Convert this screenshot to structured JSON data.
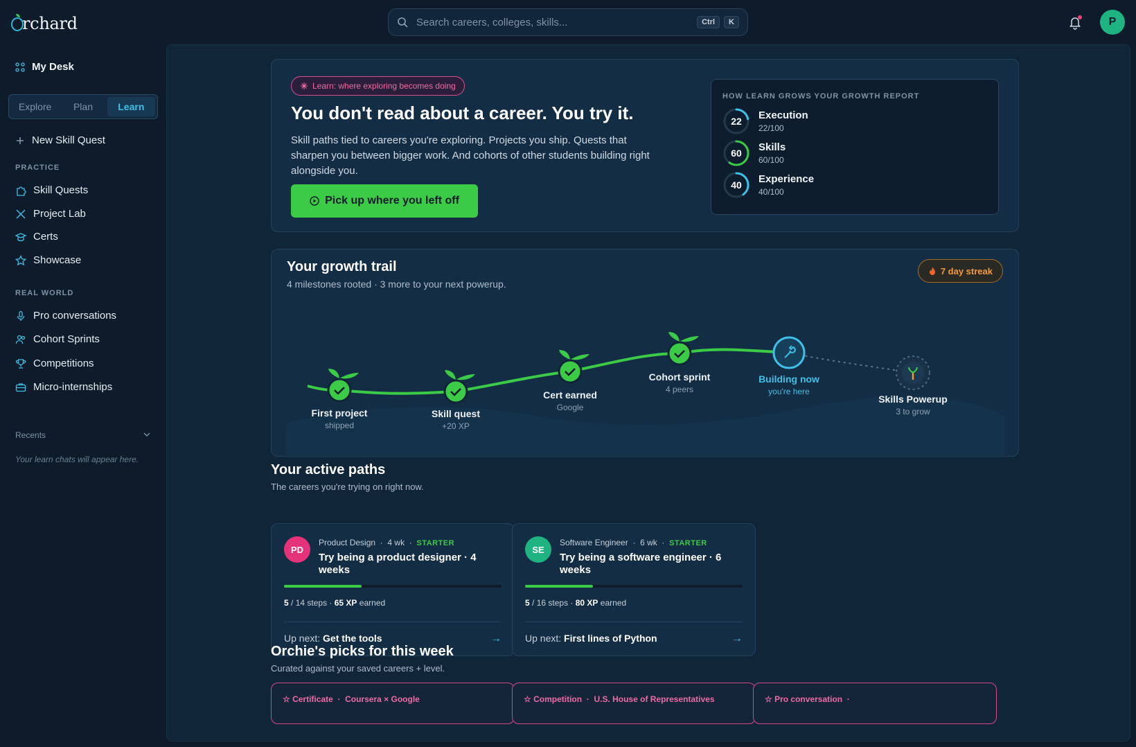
{
  "app": {
    "name": "rchard",
    "logo_letter": "O"
  },
  "search": {
    "placeholder": "Search careers, colleges, skills...",
    "kbd1": "Ctrl",
    "kbd2": "K"
  },
  "user": {
    "initial": "P"
  },
  "sidebar": {
    "my_desk": "My Desk",
    "tabs": [
      {
        "label": "Explore"
      },
      {
        "label": "Plan"
      },
      {
        "label": "Learn",
        "active": true
      }
    ],
    "new_quest": "New Skill Quest",
    "practice_title": "PRACTICE",
    "practice": [
      {
        "label": "Skill Quests",
        "icon": "puzzle-icon"
      },
      {
        "label": "Project Lab",
        "icon": "tools-icon"
      },
      {
        "label": "Certs",
        "icon": "graduation-cap-icon"
      },
      {
        "label": "Showcase",
        "icon": "star-icon"
      }
    ],
    "real_world_title": "REAL WORLD",
    "real_world": [
      {
        "label": "Pro conversations",
        "icon": "microphone-icon"
      },
      {
        "label": "Cohort Sprints",
        "icon": "users-icon"
      },
      {
        "label": "Competitions",
        "icon": "trophy-icon"
      },
      {
        "label": "Micro-internships",
        "icon": "briefcase-icon"
      }
    ],
    "recents_title": "Recents",
    "recents_empty": "Your learn chats will appear here."
  },
  "hero": {
    "pill": "Learn: where exploring becomes doing",
    "title": "You don't read about a career. You try it.",
    "body": "Skill paths tied to careers you're exploring. Projects you ship. Quests that sharpen you between bigger work. And cohorts of other students building right alongside you.",
    "cta": "Pick up where you left off",
    "report": {
      "title": "HOW LEARN GROWS YOUR GROWTH REPORT",
      "rows": [
        {
          "value": "22",
          "label": "Execution",
          "sub": "22/100",
          "pct": 0.22
        },
        {
          "value": "60",
          "label": "Skills",
          "sub": "60/100",
          "pct": 0.6
        },
        {
          "value": "40",
          "label": "Experience",
          "sub": "40/100",
          "pct": 0.4
        }
      ]
    }
  },
  "trail": {
    "title": "Your growth trail",
    "subtitle": "4 milestones rooted · 3 more to your next powerup.",
    "streak": "7 day streak",
    "milestones": [
      {
        "label": "First project",
        "sub": "shipped",
        "state": "done"
      },
      {
        "label": "Skill quest",
        "sub": "+20 XP",
        "state": "done"
      },
      {
        "label": "Cert earned",
        "sub": "Google",
        "state": "done"
      },
      {
        "label": "Cohort sprint",
        "sub": "4 peers",
        "state": "done"
      },
      {
        "label": "Building now",
        "sub": "you're here",
        "state": "current"
      },
      {
        "label": "Skills Powerup",
        "sub": "3 to grow",
        "state": "locked"
      }
    ]
  },
  "paths": {
    "title": "Your active paths",
    "subtitle": "The careers you're trying on right now.",
    "items": [
      {
        "initials": "PD",
        "color": "#e5337a",
        "career": "Product Design",
        "duration": "4 wk",
        "level": "STARTER",
        "title": "Try being a product designer · 4 weeks",
        "done": "5",
        "total": "/ 14 steps ·",
        "xp": "65 XP",
        "xp_suffix": "earned",
        "progress": 0.357,
        "next_prefix": "Up next:",
        "next": "Get the tools"
      },
      {
        "initials": "SE",
        "color": "#1fb381",
        "career": "Software Engineer",
        "duration": "6 wk",
        "level": "STARTER",
        "title": "Try being a software engineer · 6 weeks",
        "done": "5",
        "total": "/ 16 steps ·",
        "xp": "80 XP",
        "xp_suffix": "earned",
        "progress": 0.3125,
        "next_prefix": "Up next:",
        "next": "First lines of Python"
      }
    ]
  },
  "picks": {
    "title": "Orchie's picks for this week",
    "subtitle": "Curated against your saved careers + level.",
    "items": [
      {
        "kind": "Certificate",
        "source": "Coursera × Google"
      },
      {
        "kind": "Competition",
        "source": "U.S. House of Representatives"
      },
      {
        "kind": "Pro conversation",
        "source": ""
      }
    ]
  },
  "colors": {
    "accent": "#3fc0e8",
    "green": "#3bcb47",
    "pink": "#f06aa5",
    "orange": "#f49a30"
  }
}
